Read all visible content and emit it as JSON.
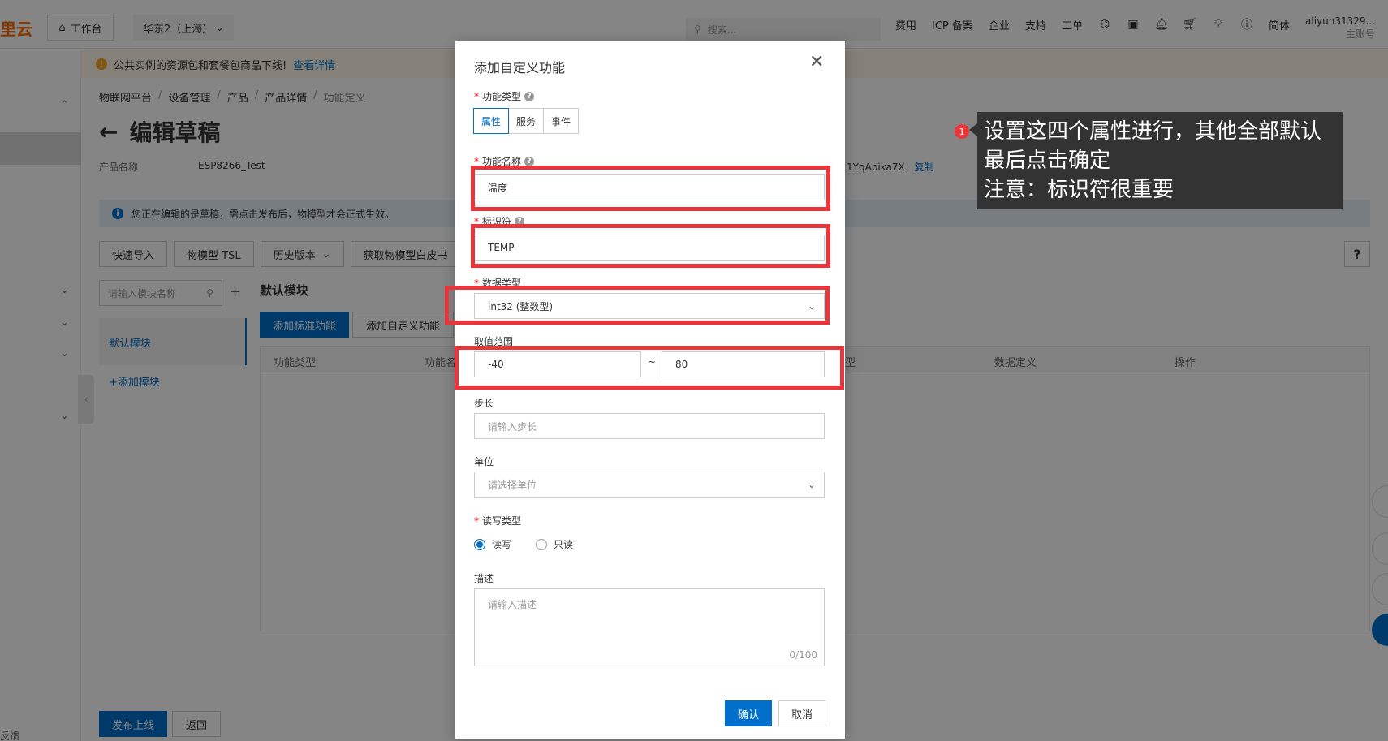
{
  "topbar": {
    "logo": "里云",
    "workbench": "工作台",
    "region": "华东2（上海）",
    "search_placeholder": "搜索...",
    "nav": [
      "费用",
      "ICP 备案",
      "企业",
      "支持",
      "工单"
    ],
    "language": "简体",
    "account_name": "aliyun31329...",
    "account_type": "主账号"
  },
  "notice": {
    "text": "公共实例的资源包和套餐包商品下线!",
    "link": "查看详情"
  },
  "breadcrumb": [
    "物联网平台",
    "设备管理",
    "产品",
    "产品详情",
    "功能定义"
  ],
  "page_title": "编辑草稿",
  "product": {
    "label": "产品名称",
    "value": "ESP8266_Test",
    "key_partial": "1YqApika7X",
    "copy": "复制"
  },
  "infobar": "您正在编辑的是草稿，需点击发布后，物模型才会正式生效。",
  "toolbar": [
    "快速导入",
    "物模型 TSL",
    "历史版本",
    "获取物模型白皮书"
  ],
  "module": {
    "search_placeholder": "请输入模块名称",
    "default": "默认模块",
    "add": "+添加模块",
    "section_title": "默认模块",
    "add_std": "添加标准功能",
    "add_custom": "添加自定义功能"
  },
  "table": {
    "headers": [
      "功能类型",
      "功能名",
      "型",
      "数据定义",
      "操作"
    ]
  },
  "footer": {
    "publish": "发布上线",
    "back": "返回",
    "feedback": "反馈"
  },
  "dialog": {
    "title": "添加自定义功能",
    "type_label": "功能类型",
    "types": [
      "属性",
      "服务",
      "事件"
    ],
    "name_label": "功能名称",
    "name_value": "温度",
    "id_label": "标识符",
    "id_value": "TEMP",
    "datatype_label": "数据类型",
    "datatype_value": "int32 (整数型)",
    "range_label": "取值范围",
    "range_min": "-40",
    "range_sep": "~",
    "range_max": "80",
    "step_label": "步长",
    "step_placeholder": "请输入步长",
    "unit_label": "单位",
    "unit_placeholder": "请选择单位",
    "rw_label": "读写类型",
    "rw_options": [
      "读写",
      "只读"
    ],
    "desc_label": "描述",
    "desc_placeholder": "请输入描述",
    "desc_count": "0/100",
    "ok": "确认",
    "cancel": "取消"
  },
  "annotation": {
    "badge": "1",
    "lines": [
      "设置这四个属性进行，其他全部默认",
      "最后点击确定",
      "注意：标识符很重要"
    ]
  },
  "colors": {
    "primary": "#0070cc",
    "highlight": "#e8363b",
    "brand": "#ff6a00"
  }
}
